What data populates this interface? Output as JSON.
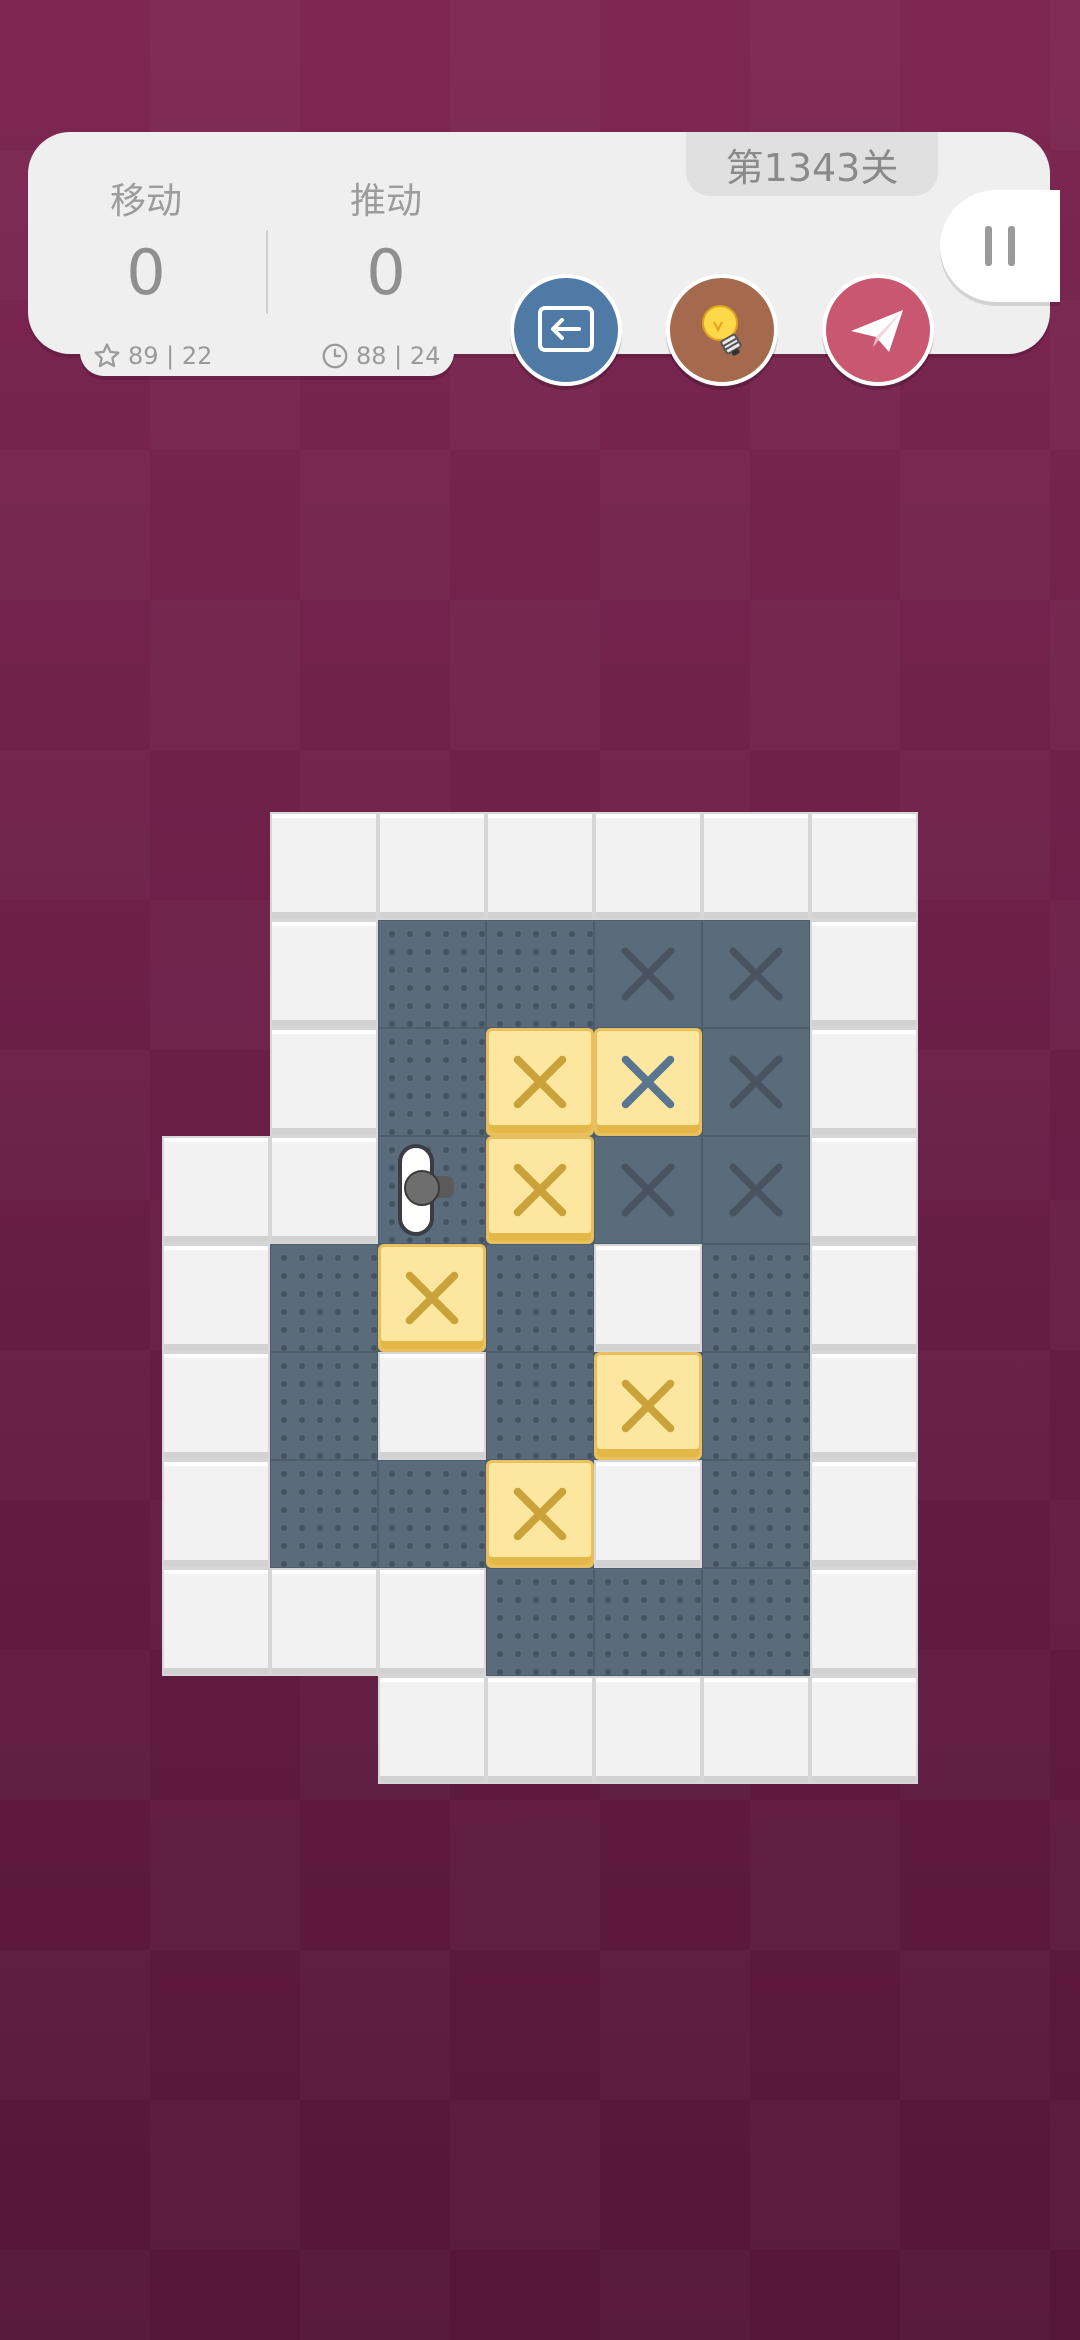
{
  "header": {
    "level_label": "第1343关",
    "moves_label": "移动",
    "moves_value": "0",
    "pushes_label": "推动",
    "pushes_value": "0",
    "best_moves": "89 | 22",
    "best_time": "88 | 24"
  },
  "buttons": {
    "undo": {
      "icon": "undo-arrow-icon",
      "color": "#4f7aa6"
    },
    "hint": {
      "icon": "lightbulb-icon",
      "color": "#a56a4e"
    },
    "share": {
      "icon": "paper-plane-icon",
      "color": "#c9576f"
    },
    "pause": {
      "icon": "pause-icon"
    }
  },
  "colors": {
    "background": "#6a1f47",
    "wall": "#f2f2f2",
    "floor": "#5a6b7c",
    "box": "#fde6a0",
    "box_mark": "#c9a23a",
    "target_mark": "#48535f",
    "target_with_box_mark": "#5a7590"
  },
  "legend": {
    "wall": "#",
    "floor": ".",
    "target": "x",
    "box": "$",
    "box_on_target": "*",
    "player": "@",
    "outside": " "
  },
  "board": [
    " ######",
    " #..xx#",
    " #.$*x#",
    "##@$xx#",
    "#.$.#.#",
    "#.#.$.#",
    "#..$#.#",
    "###...#",
    "  #####"
  ]
}
